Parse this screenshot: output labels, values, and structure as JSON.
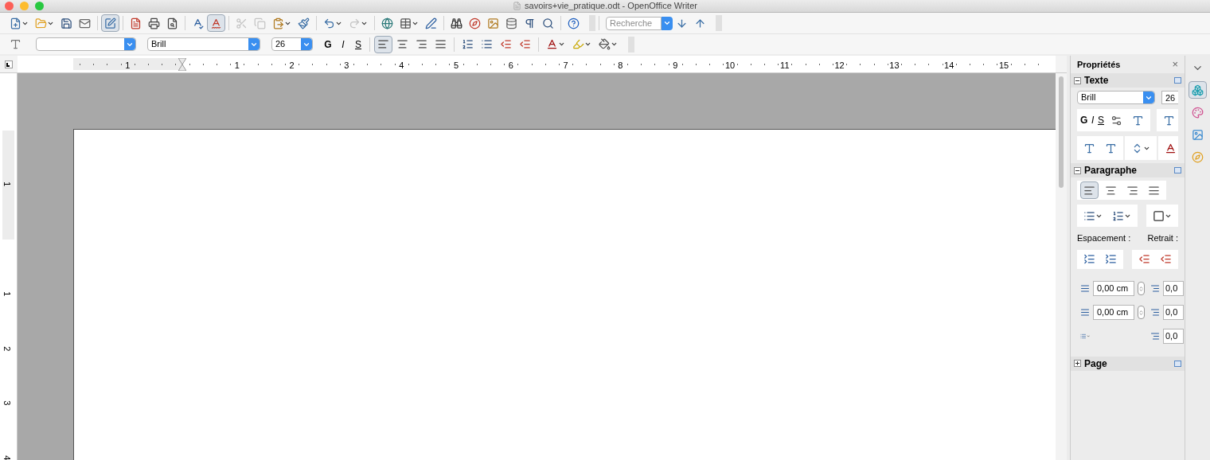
{
  "window": {
    "title": "savoirs+vie_pratique.odt - OpenOffice Writer"
  },
  "toolbar": {
    "edit_mode_selected": true,
    "auto_spellcheck_selected": true,
    "cut_disabled": true,
    "copy_disabled": true,
    "redo_disabled": true,
    "search": {
      "placeholder": "Recherche"
    }
  },
  "format_bar": {
    "font": "Brill",
    "size": "26",
    "bold": "G",
    "italic": "I",
    "underline": "S",
    "align_buttons": [
      {
        "selected": true
      },
      {
        "selected": false
      },
      {
        "selected": false
      },
      {
        "selected": false
      }
    ]
  },
  "ruler": {
    "left_numbers": [
      "1"
    ],
    "numbers": [
      "1",
      "2",
      "3",
      "4",
      "5",
      "6",
      "7",
      "8",
      "9",
      "10",
      "11",
      "12",
      "13",
      "14",
      "15"
    ]
  },
  "vertical_ruler": {
    "top_numbers": [
      "1"
    ],
    "numbers": [
      "1",
      "2",
      "3",
      "4"
    ]
  },
  "sidebar": {
    "title": "Propriétés",
    "close": "×",
    "text_section": {
      "title": "Texte",
      "expanded": true,
      "font": "Brill",
      "size": "26",
      "bold": "G",
      "italic": "I",
      "underline": "S"
    },
    "paragraph_section": {
      "title": "Paragraphe",
      "expanded": true,
      "align_buttons": [
        {
          "selected": true
        },
        {
          "selected": false
        },
        {
          "selected": false
        },
        {
          "selected": false
        }
      ],
      "spacing_label": "Espacement :",
      "indent_label": "Retrait :",
      "spacing_fields": [
        "0,00 cm",
        "0,00 cm"
      ],
      "indent_fields": [
        "0,0",
        "0,0",
        "0,0"
      ]
    },
    "page_section": {
      "title": "Page",
      "expanded": false
    },
    "tabs": [
      {
        "selected": true
      },
      {
        "selected": false
      },
      {
        "selected": false
      },
      {
        "selected": false
      }
    ]
  }
}
